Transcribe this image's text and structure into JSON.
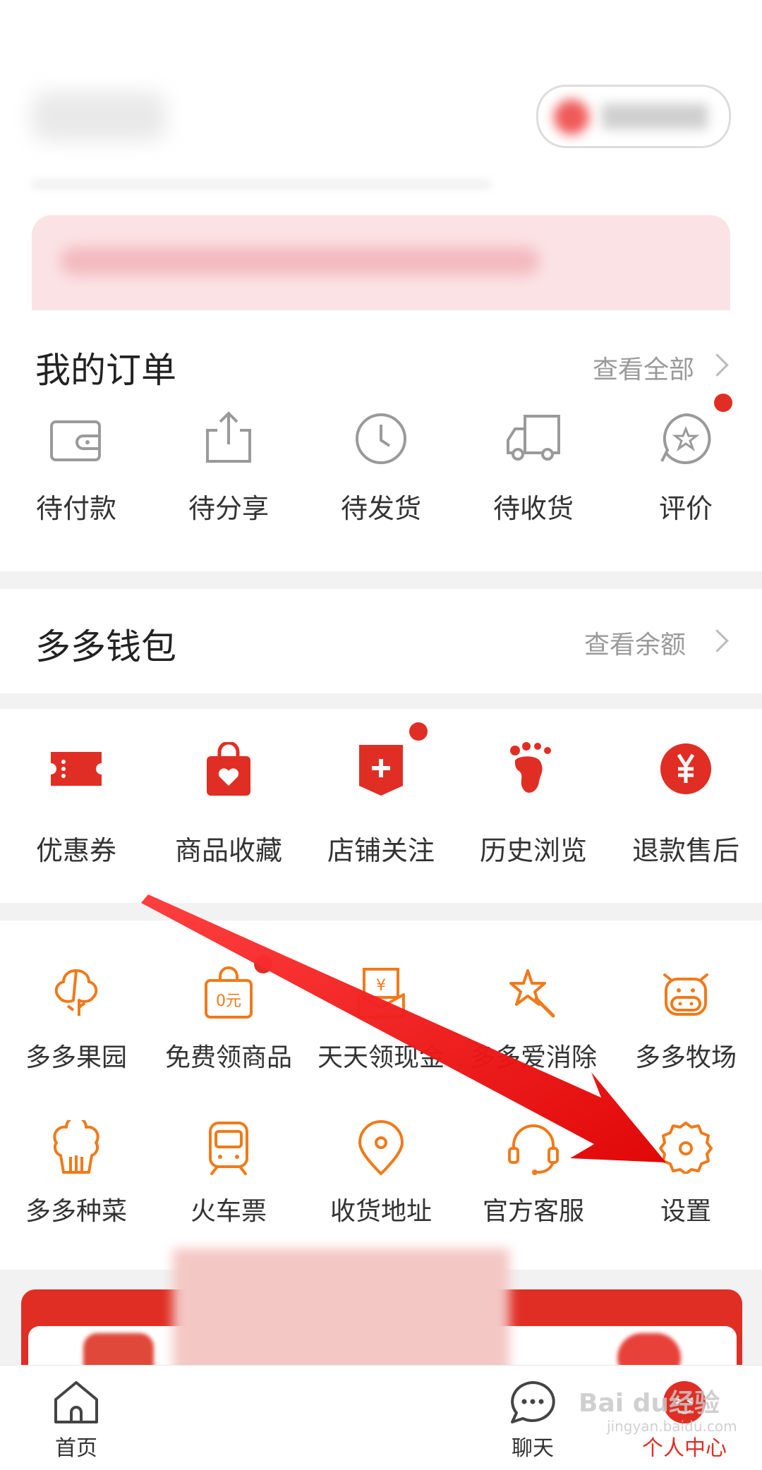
{
  "orders": {
    "title": "我的订单",
    "view_all": "查看全部",
    "items": [
      {
        "label": "待付款",
        "icon": "wallet-icon"
      },
      {
        "label": "待分享",
        "icon": "share-icon"
      },
      {
        "label": "待发货",
        "icon": "clock-icon"
      },
      {
        "label": "待收货",
        "icon": "truck-icon"
      },
      {
        "label": "评价",
        "icon": "review-icon",
        "badge": true
      }
    ]
  },
  "wallet": {
    "title": "多多钱包",
    "view_balance": "查看余额"
  },
  "shortcuts": [
    {
      "label": "优惠券",
      "icon": "coupon-icon"
    },
    {
      "label": "商品收藏",
      "icon": "favorite-bag-icon"
    },
    {
      "label": "店铺关注",
      "icon": "store-follow-icon",
      "badge": true
    },
    {
      "label": "历史浏览",
      "icon": "footprint-icon"
    },
    {
      "label": "退款售后",
      "icon": "refund-icon"
    }
  ],
  "services_row1": [
    {
      "label": "多多果园",
      "icon": "tree-icon"
    },
    {
      "label": "免费领商品",
      "icon": "free-bag-icon",
      "badge": true,
      "bag_text": "0元"
    },
    {
      "label": "天天领现金",
      "icon": "cash-envelope-icon",
      "envelope_text": "¥"
    },
    {
      "label": "多多爱消除",
      "icon": "star-wand-icon"
    },
    {
      "label": "多多牧场",
      "icon": "cow-icon"
    }
  ],
  "services_row2": [
    {
      "label": "多多种菜",
      "icon": "cabbage-icon"
    },
    {
      "label": "火车票",
      "icon": "train-icon"
    },
    {
      "label": "收货地址",
      "icon": "location-pin-icon"
    },
    {
      "label": "官方客服",
      "icon": "headset-icon"
    },
    {
      "label": "设置",
      "icon": "gear-icon"
    }
  ],
  "bottom_nav": [
    {
      "label": "首页",
      "icon": "home-icon"
    },
    {
      "label": "聊天",
      "icon": "chat-icon"
    },
    {
      "label": "个人中心",
      "icon": "profile-icon",
      "active": true
    }
  ],
  "watermark": {
    "main": "Bai du经验",
    "sub": "jingyan.baidu.com"
  },
  "colors": {
    "brand_red": "#e02e24",
    "service_orange": "#f07a1a",
    "gray_icon": "#9a9a9a"
  }
}
